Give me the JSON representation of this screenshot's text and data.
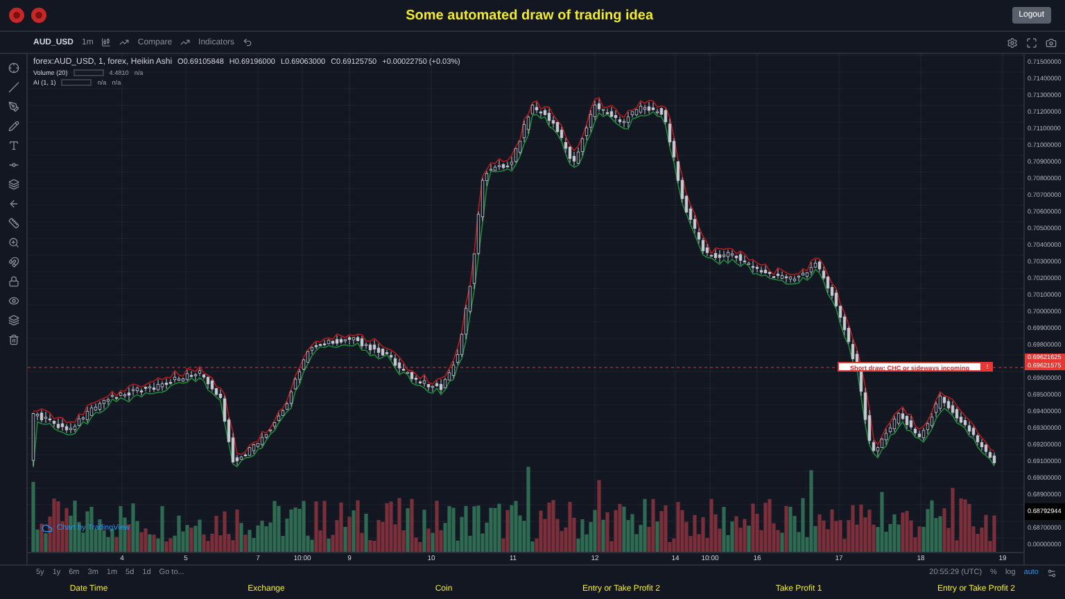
{
  "header": {
    "title": "Some automated draw of trading idea",
    "logout": "Logout"
  },
  "toolbar": {
    "symbol": "AUD_USD",
    "interval": "1m",
    "compare": "Compare",
    "indicators": "Indicators"
  },
  "legend": {
    "title": "forex:AUD_USD, 1, forex, Heikin Ashi",
    "ohlc": [
      {
        "label": "O",
        "value": "0.69105848"
      },
      {
        "label": "H",
        "value": "0.69196000"
      },
      {
        "label": "L",
        "value": "0.69063000"
      },
      {
        "label": "C",
        "value": "0.69125750"
      }
    ],
    "change": "+0.00022750 (+0.03%)"
  },
  "studies": [
    {
      "name": "Volume (20)",
      "values": [
        "4.4810",
        "n/a"
      ]
    },
    {
      "name": "AI (1, 1)",
      "values": [
        "n/a",
        "n/a"
      ]
    }
  ],
  "alert": {
    "text": "Short draw: CHC or sideways incoming",
    "badge": "!"
  },
  "watermark": "Chart by TradingView",
  "price_axis": [
    {
      "kind": "tick",
      "text": "0.71500000"
    },
    {
      "kind": "tick",
      "text": "0.71400000"
    },
    {
      "kind": "tick",
      "text": "0.71300000"
    },
    {
      "kind": "tick",
      "text": "0.71200000"
    },
    {
      "kind": "tick",
      "text": "0.71100000"
    },
    {
      "kind": "tick",
      "text": "0.71000000"
    },
    {
      "kind": "tick",
      "text": "0.70900000"
    },
    {
      "kind": "tick",
      "text": "0.70800000"
    },
    {
      "kind": "tick",
      "text": "0.70700000"
    },
    {
      "kind": "tick",
      "text": "0.70600000"
    },
    {
      "kind": "tick",
      "text": "0.70500000"
    },
    {
      "kind": "tick",
      "text": "0.70400000"
    },
    {
      "kind": "tick",
      "text": "0.70300000"
    },
    {
      "kind": "tick",
      "text": "0.70200000"
    },
    {
      "kind": "tick",
      "text": "0.70100000"
    },
    {
      "kind": "tick",
      "text": "0.70000000"
    },
    {
      "kind": "tick",
      "text": "0.69900000"
    },
    {
      "kind": "tick",
      "text": "0.69800000"
    },
    {
      "kind": "alert",
      "text": "0.69621625"
    },
    {
      "kind": "alert",
      "text": "0.69621575"
    },
    {
      "kind": "tick",
      "text": "0.69600000"
    },
    {
      "kind": "tick",
      "text": "0.69500000"
    },
    {
      "kind": "tick",
      "text": "0.69400000"
    },
    {
      "kind": "tick",
      "text": "0.69300000"
    },
    {
      "kind": "tick",
      "text": "0.69200000"
    },
    {
      "kind": "tick",
      "text": "0.69100000"
    },
    {
      "kind": "tick",
      "text": "0.69000000"
    },
    {
      "kind": "tick",
      "text": "0.68900000"
    },
    {
      "kind": "last",
      "text": "0.68792944"
    },
    {
      "kind": "tick",
      "text": "0.68700000"
    },
    {
      "kind": "tick",
      "text": "0.00000000"
    }
  ],
  "time_axis": [
    "4",
    "5",
    "7",
    "10:00",
    "9",
    "10",
    "11",
    "12",
    "14",
    "10:00",
    "16",
    "17",
    "18",
    "19"
  ],
  "ranges": [
    "5y",
    "1y",
    "6m",
    "3m",
    "1m",
    "5d",
    "1d"
  ],
  "goto": "Go to...",
  "clock": "20:55:29 (UTC)",
  "scale_options": [
    {
      "text": "%",
      "selected": false
    },
    {
      "text": "log",
      "selected": false
    },
    {
      "text": "auto",
      "selected": true
    }
  ],
  "footer": [
    "Date Time",
    "Exchange",
    "Coin",
    "Entry or Take Profit 2",
    "Take Profit 1",
    "Entry or Take Profit 2"
  ]
}
